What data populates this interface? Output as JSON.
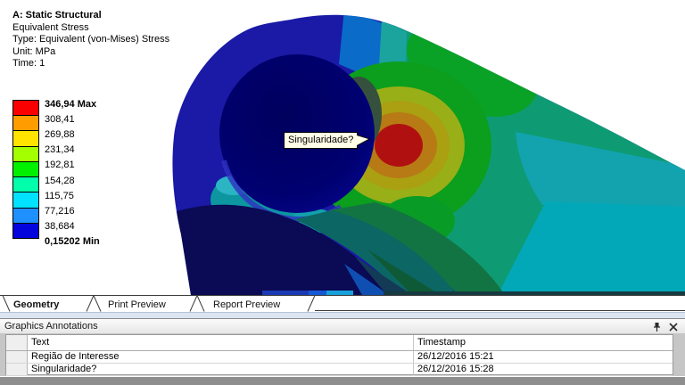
{
  "viewport": {
    "result_header": {
      "title": "A: Static Structural",
      "lines": [
        "Equivalent Stress",
        "Type: Equivalent (von-Mises) Stress",
        "Unit: MPa",
        "Time: 1"
      ]
    },
    "legend": {
      "labels": [
        "346,94 Max",
        "308,41",
        "269,88",
        "231,34",
        "192,81",
        "154,28",
        "115,75",
        "77,216",
        "38,684",
        "0,15202 Min"
      ],
      "colors": [
        "#fa0000",
        "#ff9d00",
        "#ffe400",
        "#a4ff00",
        "#00f000",
        "#00ffaa",
        "#00e2ff",
        "#1e90ff",
        "#0404dd"
      ]
    },
    "callout": {
      "text": "Singularidade?"
    }
  },
  "tabs": {
    "items": [
      {
        "label": "Geometry",
        "active": true
      },
      {
        "label": "Print Preview",
        "active": false
      },
      {
        "label": "Report Preview",
        "active": false
      }
    ]
  },
  "annotations_panel": {
    "title": "Graphics Annotations",
    "columns": [
      "Text",
      "Timestamp"
    ],
    "rows": [
      {
        "text": "Região de Interesse",
        "timestamp": "26/12/2016 15:21"
      },
      {
        "text": "Singularidade?",
        "timestamp": "26/12/2016 15:28"
      }
    ],
    "icons": {
      "pin": "pin-icon",
      "close": "close-icon"
    }
  }
}
